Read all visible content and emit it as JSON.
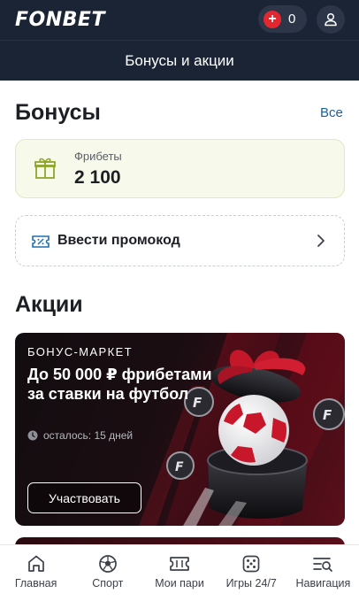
{
  "header": {
    "logo": "FONBET",
    "balance": "0",
    "balance_plus": "+"
  },
  "subheader": {
    "title": "Бонусы и акции"
  },
  "bonuses": {
    "title": "Бонусы",
    "see_all": "Все",
    "freebets": {
      "label": "Фрибеты",
      "value": "2 100"
    },
    "promo_code": {
      "label": "Ввести промокод"
    }
  },
  "promotions": {
    "title": "Акции",
    "banner": {
      "tag": "БОНУС-МАРКЕТ",
      "title": "До 50 000 ₽ фрибетами за ставки на футбол",
      "timer": "осталось: 15 дней",
      "button": "Участвовать"
    }
  },
  "bottom_nav": [
    {
      "label": "Главная",
      "icon": "home-icon"
    },
    {
      "label": "Спорт",
      "icon": "soccer-ball-icon"
    },
    {
      "label": "Мои пари",
      "icon": "ticket-icon"
    },
    {
      "label": "Игры 24/7",
      "icon": "dice-icon"
    },
    {
      "label": "Навигация",
      "icon": "menu-search-icon"
    }
  ],
  "colors": {
    "header_bg": "#1b2434",
    "accent_link": "#1e5fa0",
    "plus_red": "#e4262f",
    "freebet_bg": "#f7f9ea",
    "gift_green": "#8ea52a"
  }
}
